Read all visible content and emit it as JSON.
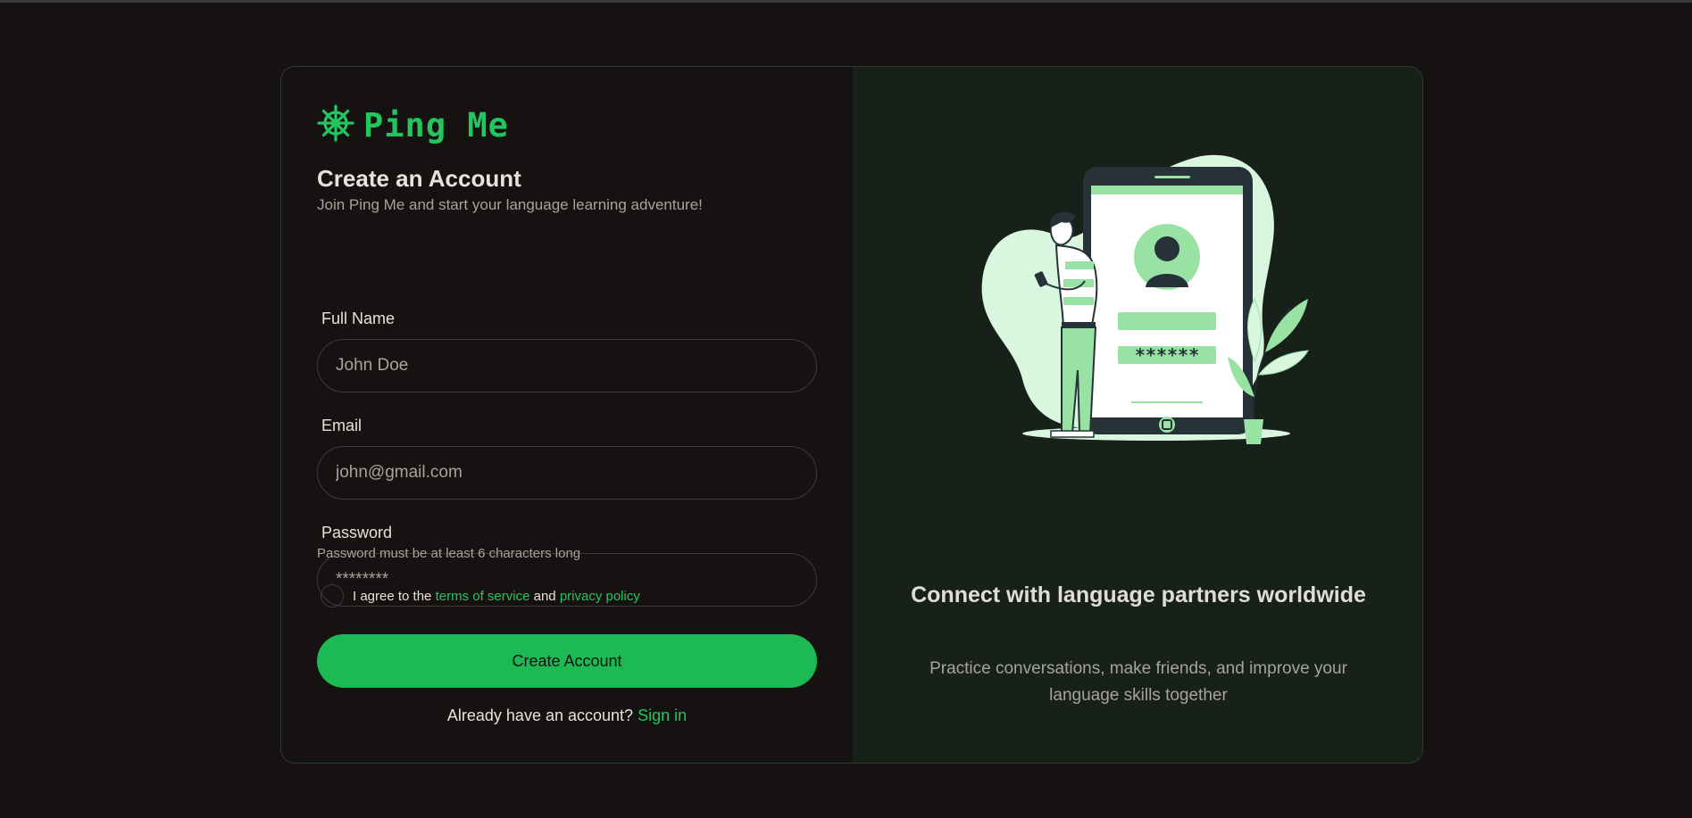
{
  "brand": {
    "name": "Ping Me",
    "icon": "ship-wheel-icon",
    "accent": "#22c55e"
  },
  "form": {
    "title": "Create an Account",
    "subtitle": "Join Ping Me and start your language learning adventure!",
    "full_name": {
      "label": "Full Name",
      "placeholder": "John Doe"
    },
    "email": {
      "label": "Email",
      "placeholder": "john@gmail.com"
    },
    "password": {
      "label": "Password",
      "placeholder": "********",
      "hint": "Password must be at least 6 characters long"
    },
    "agree": {
      "prefix": "I agree to the",
      "terms": "terms of service",
      "and": "and",
      "privacy": "privacy policy"
    },
    "submit_label": "Create Account",
    "signin_prompt": "Already have an account?",
    "signin_link": "Sign in"
  },
  "promo": {
    "illustration_password": "******",
    "title": "Connect with language partners worldwide",
    "text": "Practice conversations, make friends, and improve your language skills together"
  },
  "colors": {
    "background": "#171212",
    "panel": "#18201a",
    "button": "#1db954",
    "illustration": "#98e2a4"
  }
}
